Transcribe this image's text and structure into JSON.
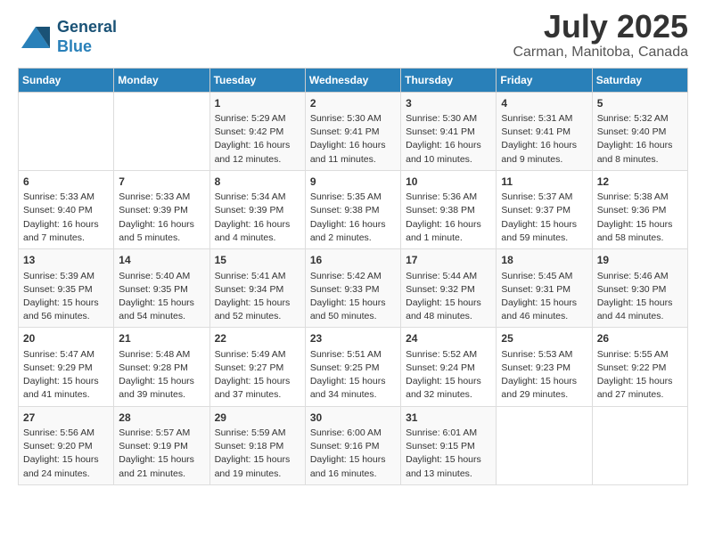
{
  "header": {
    "logo_line1": "General",
    "logo_line2": "Blue",
    "title": "July 2025",
    "subtitle": "Carman, Manitoba, Canada"
  },
  "days_of_week": [
    "Sunday",
    "Monday",
    "Tuesday",
    "Wednesday",
    "Thursday",
    "Friday",
    "Saturday"
  ],
  "weeks": [
    [
      {
        "day": "",
        "info": ""
      },
      {
        "day": "",
        "info": ""
      },
      {
        "day": "1",
        "info": "Sunrise: 5:29 AM\nSunset: 9:42 PM\nDaylight: 16 hours and 12 minutes."
      },
      {
        "day": "2",
        "info": "Sunrise: 5:30 AM\nSunset: 9:41 PM\nDaylight: 16 hours and 11 minutes."
      },
      {
        "day": "3",
        "info": "Sunrise: 5:30 AM\nSunset: 9:41 PM\nDaylight: 16 hours and 10 minutes."
      },
      {
        "day": "4",
        "info": "Sunrise: 5:31 AM\nSunset: 9:41 PM\nDaylight: 16 hours and 9 minutes."
      },
      {
        "day": "5",
        "info": "Sunrise: 5:32 AM\nSunset: 9:40 PM\nDaylight: 16 hours and 8 minutes."
      }
    ],
    [
      {
        "day": "6",
        "info": "Sunrise: 5:33 AM\nSunset: 9:40 PM\nDaylight: 16 hours and 7 minutes."
      },
      {
        "day": "7",
        "info": "Sunrise: 5:33 AM\nSunset: 9:39 PM\nDaylight: 16 hours and 5 minutes."
      },
      {
        "day": "8",
        "info": "Sunrise: 5:34 AM\nSunset: 9:39 PM\nDaylight: 16 hours and 4 minutes."
      },
      {
        "day": "9",
        "info": "Sunrise: 5:35 AM\nSunset: 9:38 PM\nDaylight: 16 hours and 2 minutes."
      },
      {
        "day": "10",
        "info": "Sunrise: 5:36 AM\nSunset: 9:38 PM\nDaylight: 16 hours and 1 minute."
      },
      {
        "day": "11",
        "info": "Sunrise: 5:37 AM\nSunset: 9:37 PM\nDaylight: 15 hours and 59 minutes."
      },
      {
        "day": "12",
        "info": "Sunrise: 5:38 AM\nSunset: 9:36 PM\nDaylight: 15 hours and 58 minutes."
      }
    ],
    [
      {
        "day": "13",
        "info": "Sunrise: 5:39 AM\nSunset: 9:35 PM\nDaylight: 15 hours and 56 minutes."
      },
      {
        "day": "14",
        "info": "Sunrise: 5:40 AM\nSunset: 9:35 PM\nDaylight: 15 hours and 54 minutes."
      },
      {
        "day": "15",
        "info": "Sunrise: 5:41 AM\nSunset: 9:34 PM\nDaylight: 15 hours and 52 minutes."
      },
      {
        "day": "16",
        "info": "Sunrise: 5:42 AM\nSunset: 9:33 PM\nDaylight: 15 hours and 50 minutes."
      },
      {
        "day": "17",
        "info": "Sunrise: 5:44 AM\nSunset: 9:32 PM\nDaylight: 15 hours and 48 minutes."
      },
      {
        "day": "18",
        "info": "Sunrise: 5:45 AM\nSunset: 9:31 PM\nDaylight: 15 hours and 46 minutes."
      },
      {
        "day": "19",
        "info": "Sunrise: 5:46 AM\nSunset: 9:30 PM\nDaylight: 15 hours and 44 minutes."
      }
    ],
    [
      {
        "day": "20",
        "info": "Sunrise: 5:47 AM\nSunset: 9:29 PM\nDaylight: 15 hours and 41 minutes."
      },
      {
        "day": "21",
        "info": "Sunrise: 5:48 AM\nSunset: 9:28 PM\nDaylight: 15 hours and 39 minutes."
      },
      {
        "day": "22",
        "info": "Sunrise: 5:49 AM\nSunset: 9:27 PM\nDaylight: 15 hours and 37 minutes."
      },
      {
        "day": "23",
        "info": "Sunrise: 5:51 AM\nSunset: 9:25 PM\nDaylight: 15 hours and 34 minutes."
      },
      {
        "day": "24",
        "info": "Sunrise: 5:52 AM\nSunset: 9:24 PM\nDaylight: 15 hours and 32 minutes."
      },
      {
        "day": "25",
        "info": "Sunrise: 5:53 AM\nSunset: 9:23 PM\nDaylight: 15 hours and 29 minutes."
      },
      {
        "day": "26",
        "info": "Sunrise: 5:55 AM\nSunset: 9:22 PM\nDaylight: 15 hours and 27 minutes."
      }
    ],
    [
      {
        "day": "27",
        "info": "Sunrise: 5:56 AM\nSunset: 9:20 PM\nDaylight: 15 hours and 24 minutes."
      },
      {
        "day": "28",
        "info": "Sunrise: 5:57 AM\nSunset: 9:19 PM\nDaylight: 15 hours and 21 minutes."
      },
      {
        "day": "29",
        "info": "Sunrise: 5:59 AM\nSunset: 9:18 PM\nDaylight: 15 hours and 19 minutes."
      },
      {
        "day": "30",
        "info": "Sunrise: 6:00 AM\nSunset: 9:16 PM\nDaylight: 15 hours and 16 minutes."
      },
      {
        "day": "31",
        "info": "Sunrise: 6:01 AM\nSunset: 9:15 PM\nDaylight: 15 hours and 13 minutes."
      },
      {
        "day": "",
        "info": ""
      },
      {
        "day": "",
        "info": ""
      }
    ]
  ]
}
